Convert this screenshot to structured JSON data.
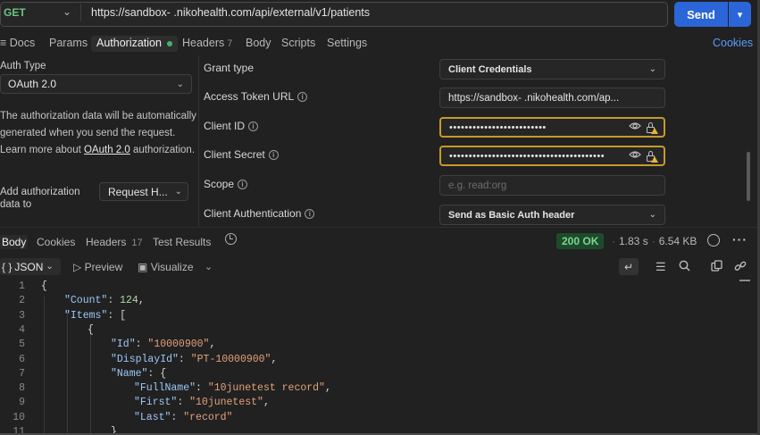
{
  "request": {
    "method": "GET",
    "url": "https://sandbox-            .nikohealth.com/api/external/v1/patients",
    "send_label": "Send"
  },
  "tabs": {
    "docs": "Docs",
    "params": "Params",
    "authorization": "Authorization",
    "headers": "Headers",
    "headers_count": "7",
    "body": "Body",
    "scripts": "Scripts",
    "settings": "Settings",
    "cookies": "Cookies"
  },
  "auth": {
    "type_label": "Auth Type",
    "type_value": "OAuth 2.0",
    "desc_1": "The authorization data will be automatically generated when you send the request. Learn more about ",
    "desc_link": "OAuth 2.0",
    "desc_2": " authorization.",
    "add_label": "Add authorization data to",
    "add_value": "Request H..."
  },
  "fields": {
    "grant_type_label": "Grant type",
    "grant_type_value": "Client Credentials",
    "token_url_label": "Access Token URL",
    "token_url_value": "https://sandbox-          .nikohealth.com/ap...",
    "client_id_label": "Client ID",
    "client_id_value": "•••••••••••••••••••••••••",
    "client_secret_label": "Client Secret",
    "client_secret_value": "••••••••••••••••••••••••••••••••••••••••",
    "scope_label": "Scope",
    "scope_placeholder": "e.g. read:org",
    "client_auth_label": "Client Authentication",
    "client_auth_value": "Send as Basic Auth header"
  },
  "response": {
    "tabs": {
      "body": "Body",
      "cookies": "Cookies",
      "headers": "Headers",
      "headers_count": "17",
      "test_results": "Test Results"
    },
    "status": "200 OK",
    "time": "1.83 s",
    "size": "6.54 KB",
    "format": "JSON",
    "preview": "Preview",
    "visualize": "Visualize"
  },
  "code_lines": [
    {
      "n": "1",
      "indent": 0,
      "parts": [
        [
          "p",
          "{"
        ]
      ]
    },
    {
      "n": "2",
      "indent": 1,
      "parts": [
        [
          "k",
          "\"Count\""
        ],
        [
          "p",
          ": "
        ],
        [
          "n",
          "124"
        ],
        [
          "p",
          ","
        ]
      ]
    },
    {
      "n": "3",
      "indent": 1,
      "parts": [
        [
          "k",
          "\"Items\""
        ],
        [
          "p",
          ": ["
        ]
      ]
    },
    {
      "n": "4",
      "indent": 2,
      "parts": [
        [
          "p",
          "{"
        ]
      ]
    },
    {
      "n": "5",
      "indent": 3,
      "parts": [
        [
          "k",
          "\"Id\""
        ],
        [
          "p",
          ": "
        ],
        [
          "s",
          "\"10000900\""
        ],
        [
          "p",
          ","
        ]
      ]
    },
    {
      "n": "6",
      "indent": 3,
      "parts": [
        [
          "k",
          "\"DisplayId\""
        ],
        [
          "p",
          ": "
        ],
        [
          "s",
          "\"PT-10000900\""
        ],
        [
          "p",
          ","
        ]
      ]
    },
    {
      "n": "7",
      "indent": 3,
      "parts": [
        [
          "k",
          "\"Name\""
        ],
        [
          "p",
          ": {"
        ]
      ]
    },
    {
      "n": "8",
      "indent": 4,
      "parts": [
        [
          "k",
          "\"FullName\""
        ],
        [
          "p",
          ": "
        ],
        [
          "s",
          "\"10junetest record\""
        ],
        [
          "p",
          ","
        ]
      ]
    },
    {
      "n": "9",
      "indent": 4,
      "parts": [
        [
          "k",
          "\"First\""
        ],
        [
          "p",
          ": "
        ],
        [
          "s",
          "\"10junetest\""
        ],
        [
          "p",
          ","
        ]
      ]
    },
    {
      "n": "10",
      "indent": 4,
      "parts": [
        [
          "k",
          "\"Last\""
        ],
        [
          "p",
          ": "
        ],
        [
          "s",
          "\"record\""
        ]
      ]
    },
    {
      "n": "11",
      "indent": 3,
      "parts": [
        [
          "p",
          "}"
        ]
      ]
    }
  ],
  "colors": {
    "accent": "#2b66d8",
    "warn_border": "#c79a2b",
    "status_ok": "#7bd58f",
    "method": "#6cc57f"
  }
}
